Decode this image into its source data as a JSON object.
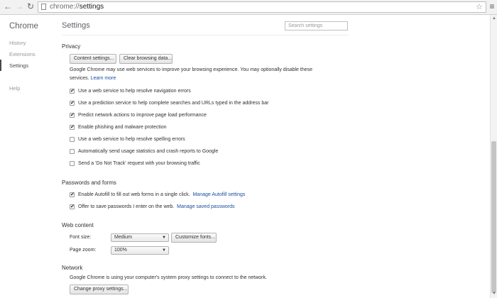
{
  "toolbar": {
    "back_glyph": "←",
    "forward_glyph": "→",
    "reload_glyph": "↻",
    "url_scheme": "chrome://",
    "url_path": "settings",
    "star_glyph": "☆",
    "menu_glyph": "≡"
  },
  "sidebar": {
    "title": "Chrome",
    "items": [
      {
        "label": "History"
      },
      {
        "label": "Extensions"
      },
      {
        "label": "Settings"
      },
      {
        "label": "Help"
      }
    ]
  },
  "main": {
    "title": "Settings",
    "search_placeholder": "Search settings",
    "privacy": {
      "title": "Privacy",
      "content_settings_btn": "Content settings...",
      "clear_browsing_btn": "Clear browsing data...",
      "description_line1": "Google Chrome may use web services to improve your browsing experience. You may optionally disable these",
      "description_line2": "services.",
      "learn_more": "Learn more",
      "options": [
        {
          "label": "Use a web service to help resolve navigation errors",
          "checked": true
        },
        {
          "label": "Use a prediction service to help complete searches and URLs typed in the address bar",
          "checked": true
        },
        {
          "label": "Predict network actions to improve page load performance",
          "checked": true
        },
        {
          "label": "Enable phishing and malware protection",
          "checked": true
        },
        {
          "label": "Use a web service to help resolve spelling errors",
          "checked": false
        },
        {
          "label": "Automatically send usage statistics and crash reports to Google",
          "checked": false
        },
        {
          "label": "Send a 'Do Not Track' request with your browsing traffic",
          "checked": false
        }
      ]
    },
    "passwords": {
      "title": "Passwords and forms",
      "autofill_label": "Enable Autofill to fill out web forms in a single click.",
      "autofill_link": "Manage Autofill settings",
      "save_pw_label": "Offer to save passwords I enter on the web.",
      "save_pw_link": "Manage saved passwords"
    },
    "web_content": {
      "title": "Web content",
      "font_size_label": "Font size:",
      "font_size_value": "Medium",
      "customize_fonts_btn": "Customize fonts...",
      "page_zoom_label": "Page zoom:",
      "page_zoom_value": "100%"
    },
    "network": {
      "title": "Network",
      "description": "Google Chrome is using your computer's system proxy settings to connect to the network.",
      "proxy_btn": "Change proxy settings..."
    }
  },
  "check_glyph": "✔",
  "caret_glyph": "▼",
  "colors": {
    "link": "#1a4ea0",
    "active_nav": "#464a4e",
    "inactive_nav": "#999999"
  }
}
